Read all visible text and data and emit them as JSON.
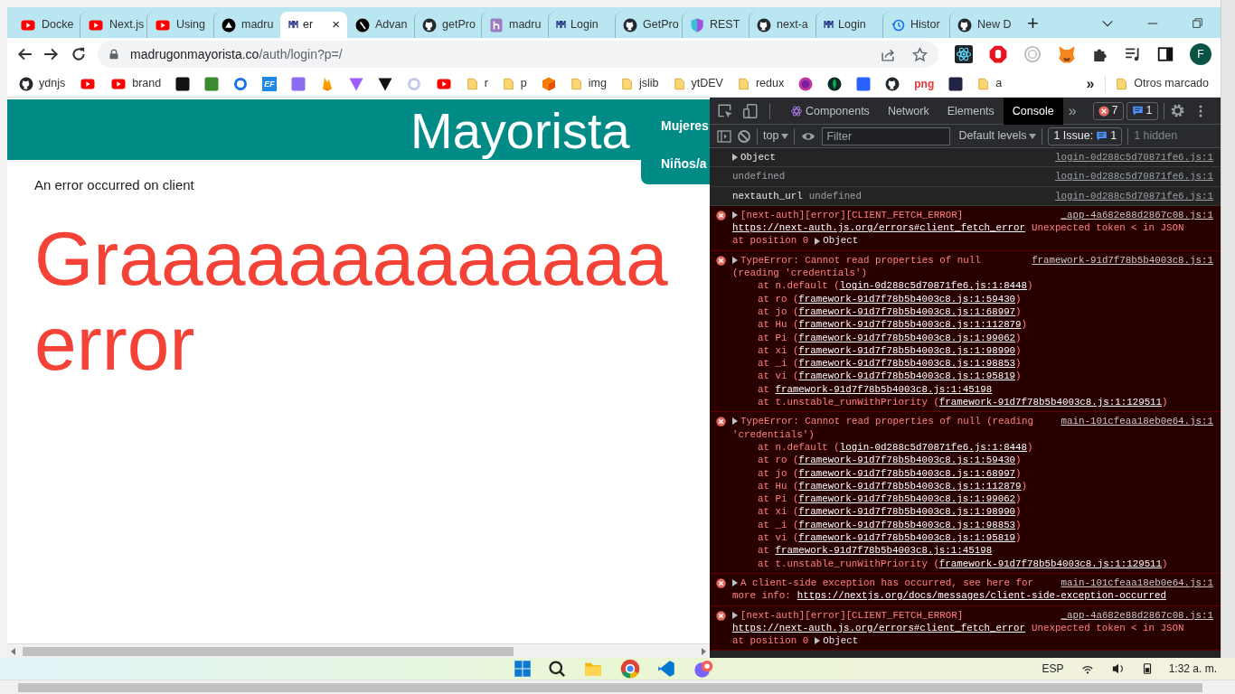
{
  "tabs": [
    {
      "title": "Docke",
      "kind": "youtube",
      "selected": false
    },
    {
      "title": "Next.js",
      "kind": "youtube",
      "selected": false
    },
    {
      "title": "Using",
      "kind": "youtube",
      "selected": false
    },
    {
      "title": "madru",
      "kind": "vercel",
      "selected": false
    },
    {
      "title": "er",
      "kind": "glyph",
      "glyph": "MM",
      "selected": true,
      "close": "×"
    },
    {
      "title": "Advan",
      "kind": "next",
      "selected": false
    },
    {
      "title": "getPro",
      "kind": "github",
      "selected": false
    },
    {
      "title": "madru",
      "kind": "heroku",
      "selected": false
    },
    {
      "title": "Login",
      "kind": "glyph",
      "glyph": "MM",
      "selected": false
    },
    {
      "title": "GetPro",
      "kind": "github",
      "selected": false
    },
    {
      "title": "REST",
      "kind": "shield",
      "selected": false
    },
    {
      "title": "next-a",
      "kind": "github",
      "selected": false
    },
    {
      "title": "Login",
      "kind": "glyph",
      "glyph": "MM",
      "selected": false
    },
    {
      "title": "Histor",
      "kind": "history",
      "selected": false
    },
    {
      "title": "New D",
      "kind": "github",
      "selected": false
    }
  ],
  "new_tab": "+",
  "address": {
    "host": "madrugonmayorista.co",
    "path": "/auth/login?p=/"
  },
  "profile": "F",
  "bookmarks": [
    {
      "label": "ydnjs",
      "kind": "github"
    },
    {
      "kind": "youtube"
    },
    {
      "label": "brand",
      "kind": "youtube"
    },
    {
      "kind": "square",
      "color": "#111111"
    },
    {
      "kind": "square",
      "color": "#3c8a2e"
    },
    {
      "kind": "ring",
      "color": "#1a73e8"
    },
    {
      "kind": "badge",
      "glyph": "EF",
      "color": "#1e88e5"
    },
    {
      "kind": "square",
      "color": "#8c6cf0"
    },
    {
      "kind": "flame",
      "color": "#ffa000"
    },
    {
      "kind": "triangle",
      "color": "#9d5cff"
    },
    {
      "kind": "triangle",
      "color": "#111111"
    },
    {
      "kind": "ring",
      "color": "#c5cae9"
    },
    {
      "kind": "youtube"
    },
    {
      "label": "r",
      "kind": "folder"
    },
    {
      "label": "p",
      "kind": "folder"
    },
    {
      "kind": "cube",
      "color": "#f57c00"
    },
    {
      "label": "img",
      "kind": "folder"
    },
    {
      "label": "jslib",
      "kind": "folder"
    },
    {
      "label": "ytDEV",
      "kind": "folder"
    },
    {
      "label": "redux",
      "kind": "folder"
    },
    {
      "kind": "circle",
      "color": "#c2399e"
    },
    {
      "kind": "leaf"
    },
    {
      "kind": "square",
      "color": "#2962ff"
    },
    {
      "kind": "github"
    },
    {
      "kind": "glyph",
      "glyph": "png",
      "color": "#e53935"
    },
    {
      "kind": "square",
      "color": "#222244"
    },
    {
      "label": "a",
      "kind": "folder"
    }
  ],
  "bookmarks_more": "»",
  "other_bookmarks": "Otros marcado",
  "page": {
    "logo": "Mayorista",
    "menu": [
      "Mujeres",
      "Niños/a"
    ],
    "message": "An error occurred on client",
    "headline": [
      "Graaaaaaaaaaaaa",
      "error"
    ]
  },
  "devtools": {
    "tabs": [
      {
        "label": "Components",
        "selected": false
      },
      {
        "label": "Network",
        "selected": false
      },
      {
        "label": "Elements",
        "selected": false
      },
      {
        "label": "Console",
        "selected": true
      }
    ],
    "more": "»",
    "error_count": "7",
    "message_count": "1",
    "context": "top",
    "filter_placeholder": "Filter",
    "levels": "Default levels",
    "issues_label": "1 Issue:",
    "issues_count": "1",
    "hidden": "1 hidden",
    "messages": [
      {
        "kind": "log",
        "source": "login-0d288c5d70871fe6.js:1",
        "lines": [
          [
            {
              "text": "Object",
              "kind": "object",
              "expandable": true
            }
          ]
        ]
      },
      {
        "kind": "log",
        "source": "login-0d288c5d70871fe6.js:1",
        "lines": [
          [
            {
              "text": "undefined",
              "kind": "muted"
            }
          ]
        ]
      },
      {
        "kind": "log",
        "source": "login-0d288c5d70871fe6.js:1",
        "lines": [
          [
            {
              "text": "nextauth_url",
              "kind": "plain"
            },
            {
              "text": "undefined",
              "kind": "muted"
            }
          ]
        ]
      },
      {
        "kind": "error",
        "source": "_app-4a682e88d2867c08.js:1",
        "expandable": true,
        "lines": [
          [
            {
              "text": "[next-auth][error][CLIENT_FETCH_ERROR]",
              "kind": "plain"
            }
          ],
          [
            {
              "text": "https://next-auth.js.org/errors#client_fetch_error",
              "kind": "link"
            },
            {
              "text": "Unexpected token < in JSON",
              "kind": "plain"
            }
          ],
          [
            {
              "text": "at position 0",
              "kind": "plain"
            },
            {
              "text": "Object",
              "kind": "object",
              "expandable": true
            }
          ]
        ]
      },
      {
        "kind": "error",
        "source": "framework-91d7f78b5b4003c8.js:1",
        "expandable": true,
        "lines": [
          [
            {
              "text": "TypeError: Cannot read properties of null",
              "kind": "plain"
            }
          ],
          [
            {
              "text": "(reading 'credentials')",
              "kind": "plain"
            }
          ]
        ],
        "stack": [
          {
            "prefix": "at n.default (",
            "location": "login-0d288c5d70871fe6.js:1:8448",
            "suffix": ")"
          },
          {
            "prefix": "at ro (",
            "location": "framework-91d7f78b5b4003c8.js:1:59430",
            "suffix": ")"
          },
          {
            "prefix": "at jo (",
            "location": "framework-91d7f78b5b4003c8.js:1:68997",
            "suffix": ")"
          },
          {
            "prefix": "at Hu (",
            "location": "framework-91d7f78b5b4003c8.js:1:112879",
            "suffix": ")"
          },
          {
            "prefix": "at Pi (",
            "location": "framework-91d7f78b5b4003c8.js:1:99062",
            "suffix": ")"
          },
          {
            "prefix": "at xi (",
            "location": "framework-91d7f78b5b4003c8.js:1:98990",
            "suffix": ")"
          },
          {
            "prefix": "at _i (",
            "location": "framework-91d7f78b5b4003c8.js:1:98853",
            "suffix": ")"
          },
          {
            "prefix": "at vi (",
            "location": "framework-91d7f78b5b4003c8.js:1:95819",
            "suffix": ")"
          },
          {
            "prefix": "at ",
            "location": "framework-91d7f78b5b4003c8.js:1:45198"
          },
          {
            "prefix": "at t.unstable_runWithPriority (",
            "location": "framework-91d7f78b5b4003c8.js:1:129511",
            "suffix": ")"
          }
        ]
      },
      {
        "kind": "error",
        "source": "main-101cfeaa18eb0e64.js:1",
        "expandable": true,
        "lines": [
          [
            {
              "text": "TypeError: Cannot read properties of null (reading",
              "kind": "plain"
            }
          ],
          [
            {
              "text": "'credentials')",
              "kind": "plain"
            }
          ]
        ],
        "stack": [
          {
            "prefix": "at n.default (",
            "location": "login-0d288c5d70871fe6.js:1:8448",
            "suffix": ")"
          },
          {
            "prefix": "at ro (",
            "location": "framework-91d7f78b5b4003c8.js:1:59430",
            "suffix": ")"
          },
          {
            "prefix": "at jo (",
            "location": "framework-91d7f78b5b4003c8.js:1:68997",
            "suffix": ")"
          },
          {
            "prefix": "at Hu (",
            "location": "framework-91d7f78b5b4003c8.js:1:112879",
            "suffix": ")"
          },
          {
            "prefix": "at Pi (",
            "location": "framework-91d7f78b5b4003c8.js:1:99062",
            "suffix": ")"
          },
          {
            "prefix": "at xi (",
            "location": "framework-91d7f78b5b4003c8.js:1:98990",
            "suffix": ")"
          },
          {
            "prefix": "at _i (",
            "location": "framework-91d7f78b5b4003c8.js:1:98853",
            "suffix": ")"
          },
          {
            "prefix": "at vi (",
            "location": "framework-91d7f78b5b4003c8.js:1:95819",
            "suffix": ")"
          },
          {
            "prefix": "at ",
            "location": "framework-91d7f78b5b4003c8.js:1:45198"
          },
          {
            "prefix": "at t.unstable_runWithPriority (",
            "location": "framework-91d7f78b5b4003c8.js:1:129511",
            "suffix": ")"
          }
        ]
      },
      {
        "kind": "error",
        "source": "main-101cfeaa18eb0e64.js:1",
        "expandable": true,
        "lines": [
          [
            {
              "text": "A client-side exception has occurred, see here for",
              "kind": "plain"
            }
          ],
          [
            {
              "text": "more info:",
              "kind": "plain"
            },
            {
              "text": "https://nextjs.org/docs/messages/client-side-exception-occurred",
              "kind": "link"
            }
          ]
        ]
      },
      {
        "kind": "error",
        "source": "_app-4a682e88d2867c08.js:1",
        "expandable": true,
        "lines": [
          [
            {
              "text": "[next-auth][error][CLIENT_FETCH_ERROR]",
              "kind": "plain"
            }
          ],
          [
            {
              "text": "https://next-auth.js.org/errors#client_fetch_error",
              "kind": "link"
            },
            {
              "text": "Unexpected token < in JSON",
              "kind": "plain"
            }
          ],
          [
            {
              "text": "at position 0",
              "kind": "plain"
            },
            {
              "text": "Object",
              "kind": "object",
              "expandable": true
            }
          ]
        ]
      }
    ]
  },
  "taskbar": {
    "language": "ESP",
    "time": "1:32 a. m."
  }
}
